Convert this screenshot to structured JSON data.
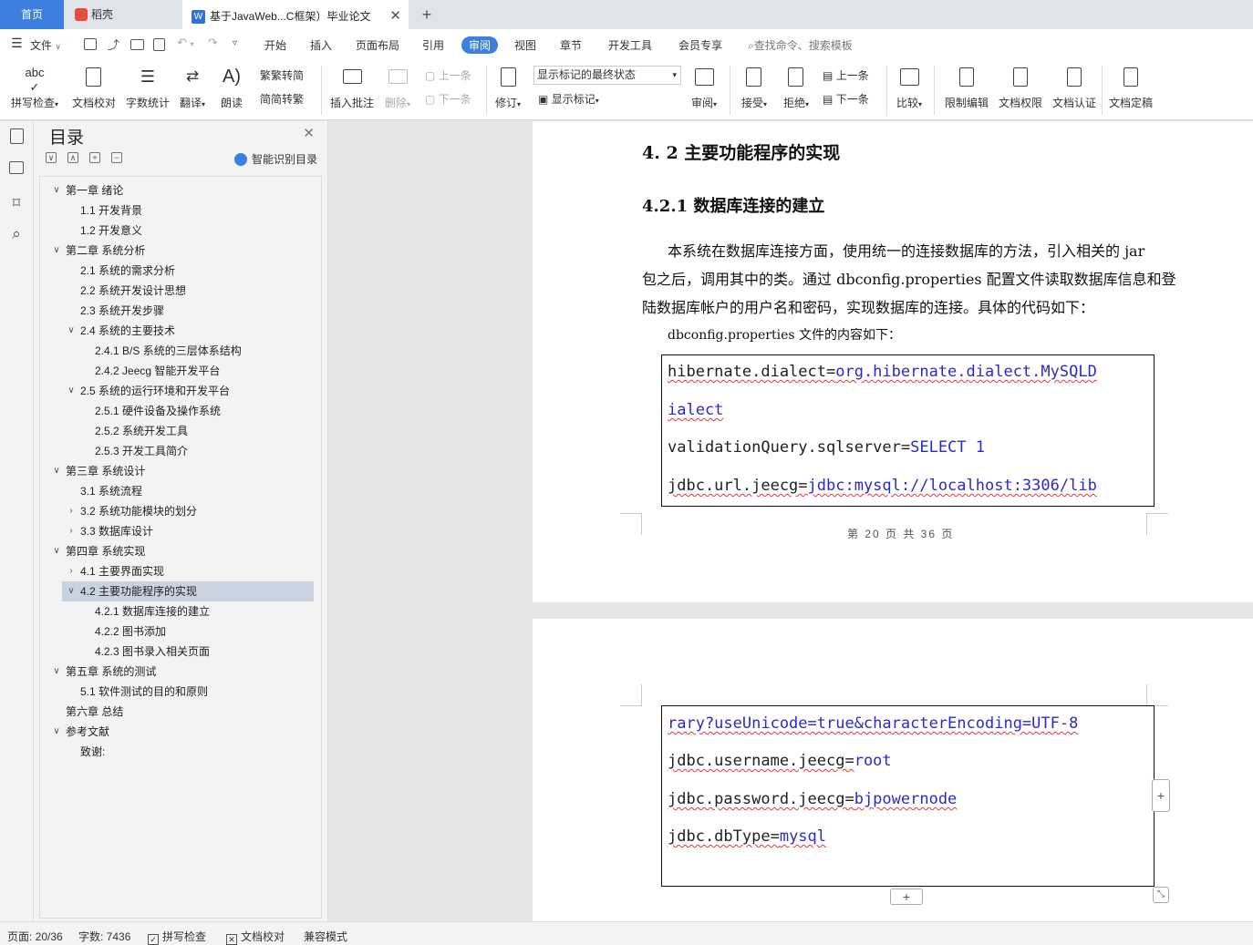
{
  "tabs": {
    "home": "首页",
    "docer": "稻壳",
    "doc": "基于JavaWeb...C框架）毕业论文"
  },
  "menu": {
    "file": "文件",
    "items": [
      "开始",
      "插入",
      "页面布局",
      "引用",
      "审阅",
      "视图",
      "章节",
      "开发工具",
      "会员专享"
    ],
    "search": "查找命令、搜索模板"
  },
  "ribbon": {
    "spell": "拼写检查",
    "proof": "文档校对",
    "wordcount": "字数统计",
    "translate": "翻译",
    "read": "朗读",
    "to_trad": "繁转简",
    "to_simp": "简转繁",
    "insert_comment": "插入批注",
    "delete": "删除",
    "prev_comment": "上一条",
    "next_comment": "下一条",
    "track": "修订",
    "markup_select": "显示标记的最终状态",
    "show_markup": "显示标记",
    "review": "审阅",
    "accept": "接受",
    "reject": "拒绝",
    "prev_change": "上一条",
    "next_change": "下一条",
    "compare": "比较",
    "restrict": "限制编辑",
    "permission": "文档权限",
    "certify": "文档认证",
    "finalize": "文档定稿"
  },
  "toc": {
    "title": "目录",
    "smart": "智能识别目录",
    "items": [
      {
        "label": "第一章  绪论"
      },
      {
        "label": "1.1  开发背景"
      },
      {
        "label": "1.2  开发意义"
      },
      {
        "label": "第二章  系统分析"
      },
      {
        "label": "2.1  系统的需求分析"
      },
      {
        "label": "2.2  系统开发设计思想"
      },
      {
        "label": "2.3 系统开发步骤"
      },
      {
        "label": "2.4  系统的主要技术"
      },
      {
        "label": "2.4.1 B/S 系统的三层体系结构"
      },
      {
        "label": "2.4.2 Jeecg  智能开发平台"
      },
      {
        "label": "2.5  系统的运行环境和开发平台"
      },
      {
        "label": "2.5.1  硬件设备及操作系统"
      },
      {
        "label": "2.5.2  系统开发工具"
      },
      {
        "label": "2.5.3  开发工具简介"
      },
      {
        "label": "第三章  系统设计"
      },
      {
        "label": "3.1 系统流程"
      },
      {
        "label": "3.2  系统功能模块的划分"
      },
      {
        "label": "3.3 数据库设计"
      },
      {
        "label": "第四章  系统实现"
      },
      {
        "label": "4.1 主要界面实现"
      },
      {
        "label": "4.2 主要功能程序的实现"
      },
      {
        "label": "4.2.1  数据库连接的建立"
      },
      {
        "label": "4.2.2 图书添加"
      },
      {
        "label": "4.2.3 图书录入相关页面"
      },
      {
        "label": "第五章  系统的测试"
      },
      {
        "label": "5.1    软件测试的目的和原则"
      },
      {
        "label": "第六章    总结"
      },
      {
        "label": "参考文献"
      },
      {
        "label": "致谢:"
      }
    ]
  },
  "document": {
    "h_42": "4. 2 主要功能程序的实现",
    "h_421": "4.2.1  数据库连接的建立",
    "para1_l1": "本系统在数据库连接方面，使用统一的连接数据库的方法，引入相关的 jar",
    "para1_l2": "包之后，调用其中的类。通过 dbconfig.properties 配置文件读取数据库信息和登",
    "para1_l3": "陆数据库帐户的用户名和密码，实现数据库的连接。具体的代码如下：",
    "para2": "dbconfig.properties 文件的内容如下：",
    "code1": {
      "l1a": "hibernate.dialect=",
      "l1b": "org.hibernate.dialect.MySQLD",
      "l2": "ialect",
      "l3a": "validationQuery.sqlserver=",
      "l3b": "SELECT 1",
      "l4a": "jdbc.url.jeecg=",
      "l4b": "jdbc:mysql://localhost:3306/lib"
    },
    "page_footer": "第 20 页 共 36 页",
    "code2": {
      "l1": "rary?useUnicode=true&characterEncoding=UTF-8",
      "l2a": "jdbc.username.jeecg=",
      "l2b": "root",
      "l3a": "jdbc.password.jeecg=",
      "l3b": "bjpowernode",
      "l4a": "jdbc.dbType=",
      "l4b": "mysql"
    }
  },
  "status": {
    "page": "页面: 20/36",
    "words": "字数: 7436",
    "spell": "拼写检查",
    "proof": "文档校对",
    "compat": "兼容模式"
  },
  "colors": {
    "accent": "#3d7fe0",
    "code_keyword": "#2a2ad0",
    "selected_toc": "#c9d3e0"
  }
}
